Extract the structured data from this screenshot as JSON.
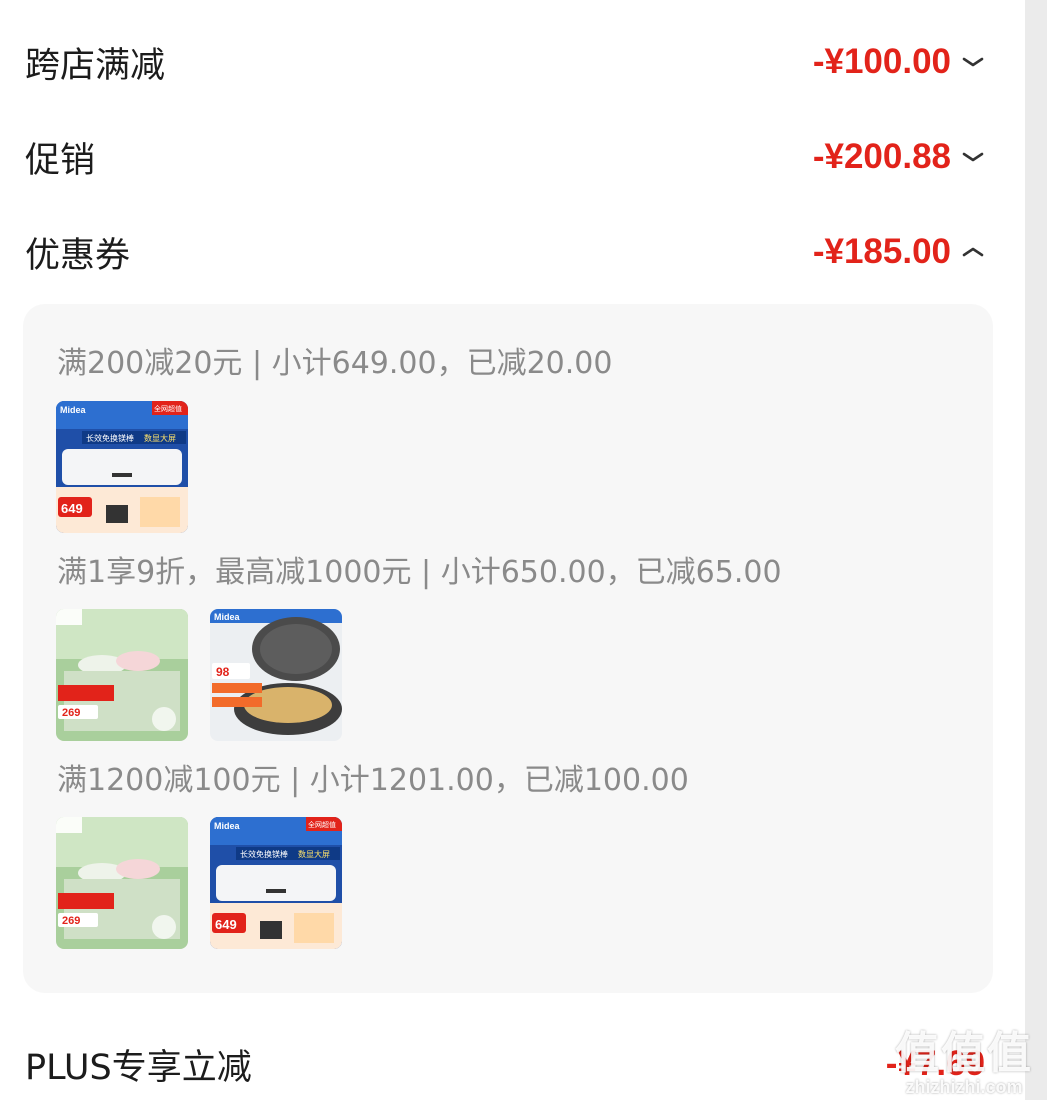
{
  "rows": {
    "cross_store": {
      "label": "跨店满减",
      "amount": "-¥100.00",
      "expanded": false
    },
    "promotion": {
      "label": "促销",
      "amount": "-¥200.88",
      "expanded": false
    },
    "coupon": {
      "label": "优惠券",
      "amount": "-¥185.00",
      "expanded": true
    },
    "plus": {
      "label": "PLUS专享立减",
      "amount": "-¥7.69"
    }
  },
  "coupon_detail": {
    "groups": [
      {
        "text": "满200减20元 | 小计649.00，已减20.00",
        "products": [
          "water-heater"
        ]
      },
      {
        "text": "满1享9折，最高减1000元 | 小计650.00，已减65.00",
        "products": [
          "bedding",
          "pan"
        ]
      },
      {
        "text": "满1200减100元 | 小计1201.00，已减100.00",
        "products": [
          "bedding",
          "water-heater"
        ]
      }
    ]
  },
  "product_labels": {
    "water_heater": {
      "brand": "Midea",
      "headline": "长效免换镁棒",
      "sub": "数显大屏",
      "price": "649",
      "corner": "全网超值"
    },
    "bedding": {
      "price": "269"
    },
    "pan": {
      "brand": "Midea",
      "price": "98"
    }
  },
  "watermark": {
    "big": "值值值",
    "small": "zhizhizhi.com"
  },
  "colors": {
    "accent_red": "#e2231a",
    "panel_bg": "#f7f7f7",
    "muted_text": "#8a8a8a"
  }
}
